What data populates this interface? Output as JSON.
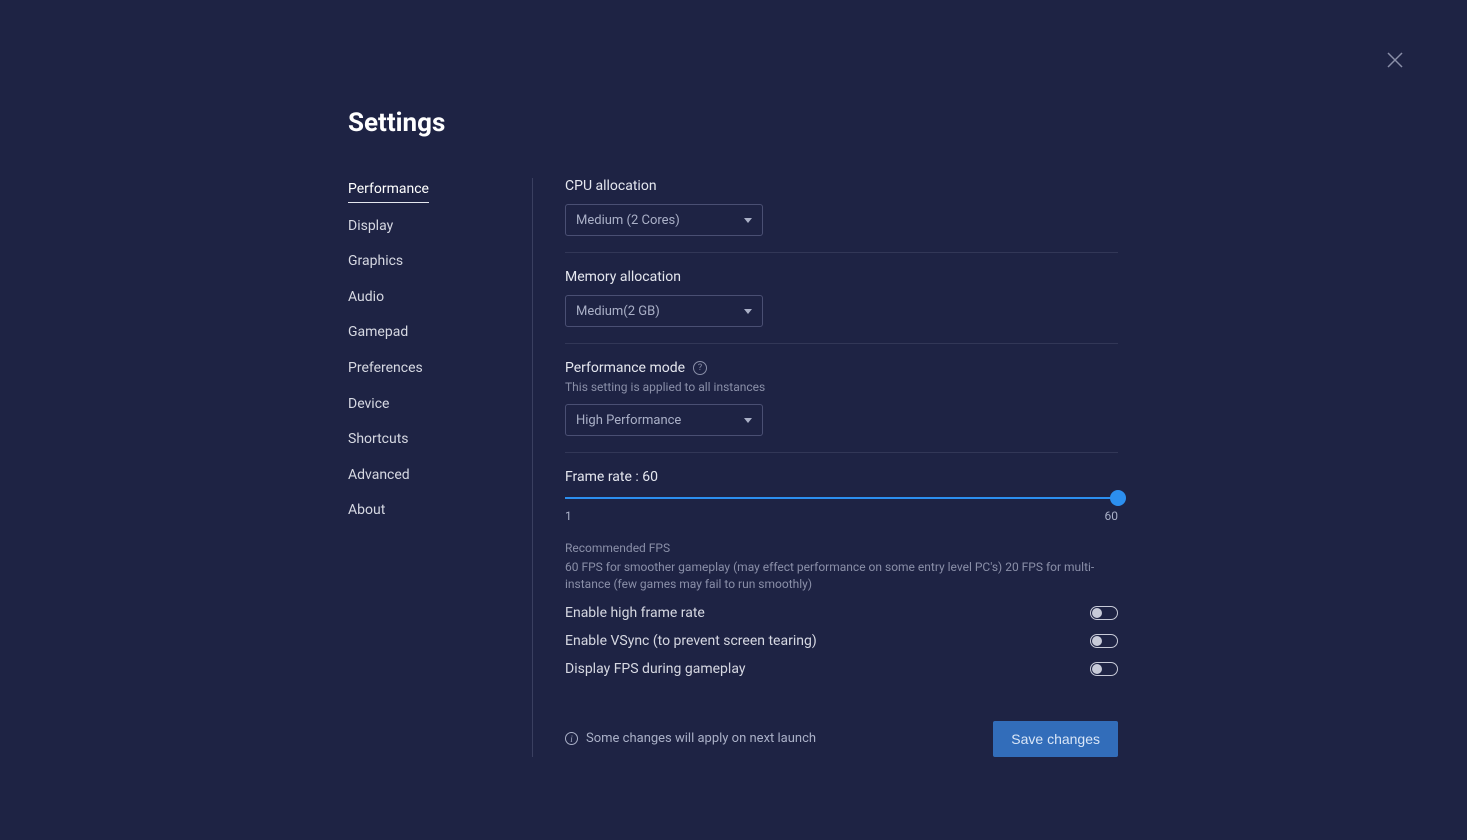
{
  "title": "Settings",
  "sidebar": {
    "items": [
      "Performance",
      "Display",
      "Graphics",
      "Audio",
      "Gamepad",
      "Preferences",
      "Device",
      "Shortcuts",
      "Advanced",
      "About"
    ],
    "active_index": 0
  },
  "cpu": {
    "label": "CPU allocation",
    "value": "Medium (2 Cores)"
  },
  "memory": {
    "label": "Memory allocation",
    "value": "Medium(2 GB)"
  },
  "perf_mode": {
    "label": "Performance mode",
    "sub": "This setting is applied to all instances",
    "value": "High Performance"
  },
  "frame_rate": {
    "label": "Frame rate : 60",
    "min": "1",
    "max": "60",
    "value": 60,
    "recommended_title": "Recommended FPS",
    "recommended_body": "60 FPS for smoother gameplay (may effect performance on some entry level PC's) 20 FPS for multi-instance (few games may fail to run smoothly)"
  },
  "toggles": {
    "hfr": {
      "label": "Enable high frame rate",
      "on": false
    },
    "vsync": {
      "label": "Enable VSync (to prevent screen tearing)",
      "on": false
    },
    "fps_display": {
      "label": "Display FPS during gameplay",
      "on": false
    }
  },
  "footer": {
    "notice": "Some changes will apply on next launch",
    "save": "Save changes"
  }
}
